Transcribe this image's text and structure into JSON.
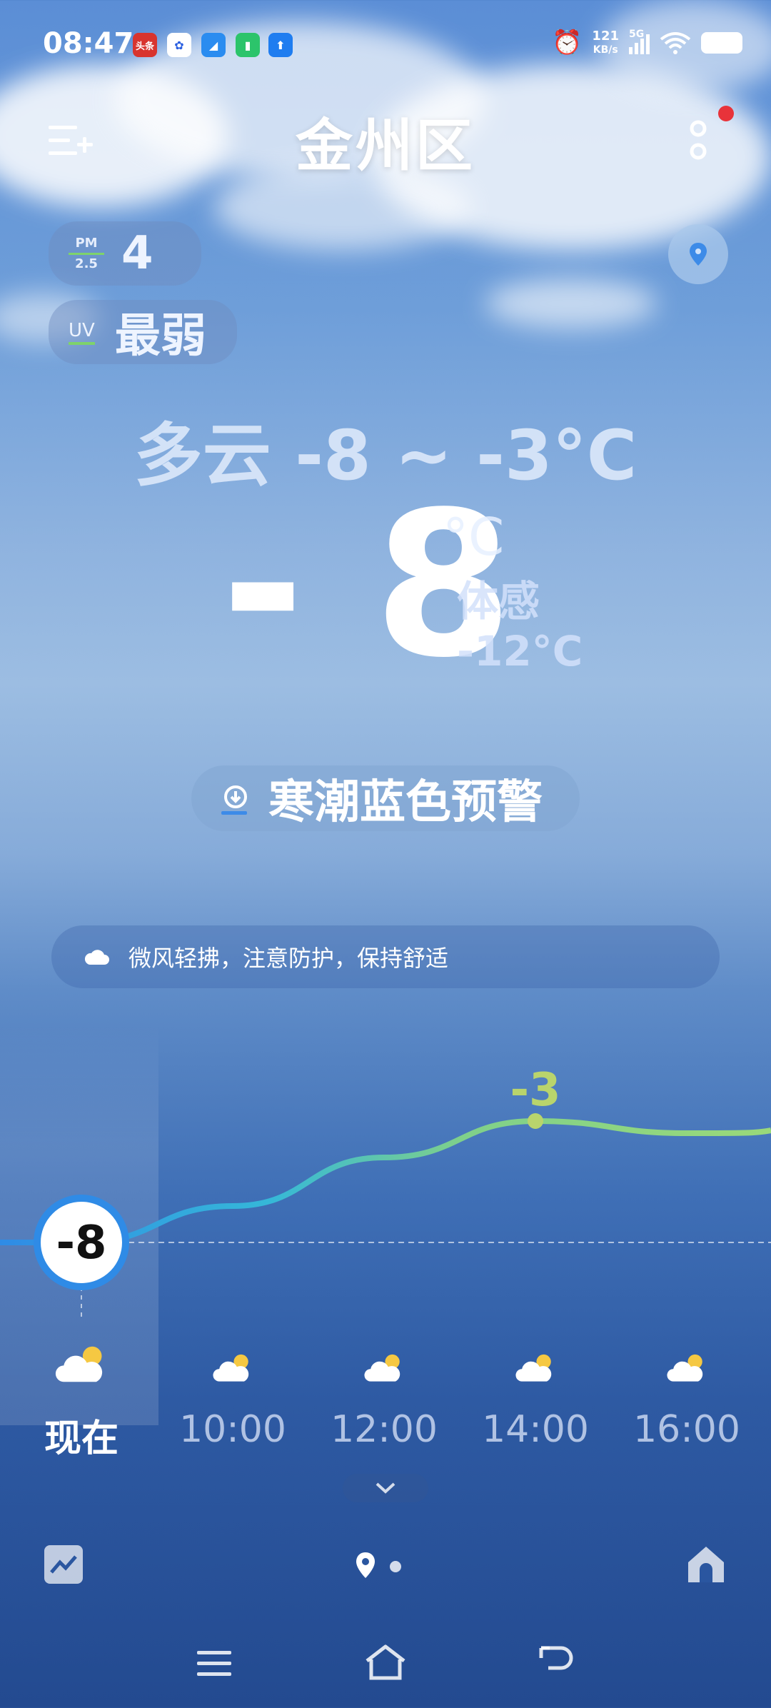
{
  "status_bar": {
    "time": "08:47",
    "net_speed_value": "121",
    "net_speed_unit": "KB/s",
    "network": "5G",
    "app_icons": [
      "toutiao-icon",
      "baidu-icon",
      "browser-icon",
      "battery-app-icon",
      "upload-icon"
    ],
    "toutiao_label": "头条"
  },
  "header": {
    "title": "金州区"
  },
  "air": {
    "pm_label_top": "PM",
    "pm_label_bottom": "2.5",
    "pm_value": "4",
    "uv_label": "UV",
    "uv_value": "最弱"
  },
  "weather": {
    "summary": "多云 -8 ~ -3°C",
    "current_temp": "- 8",
    "unit": "°C",
    "feels_like_label": "体感",
    "feels_like_value": "-12°C",
    "alert": "寒潮蓝色预警",
    "tip": "微风轻拂，注意防护，保持舒适"
  },
  "chart_data": {
    "type": "line",
    "x": [
      "现在",
      "10:00",
      "12:00",
      "14:00",
      "16:00"
    ],
    "series": [
      {
        "values": [
          -8,
          -6.5,
          -4.5,
          -3,
          -3.5
        ]
      }
    ],
    "labels": {
      "current": "-8",
      "max": "-3"
    }
  },
  "hourly": [
    {
      "label": "现在",
      "icon": "partly-cloudy-icon"
    },
    {
      "label": "10:00",
      "icon": "partly-cloudy-icon"
    },
    {
      "label": "12:00",
      "icon": "partly-cloudy-icon"
    },
    {
      "label": "14:00",
      "icon": "partly-cloudy-icon"
    },
    {
      "label": "16:00",
      "icon": "partly-cloudy-icon"
    }
  ],
  "colors": {
    "accent_blue": "#2f8be6",
    "curve_green": "#9ad97a",
    "alert_dot": "#e8333a"
  }
}
